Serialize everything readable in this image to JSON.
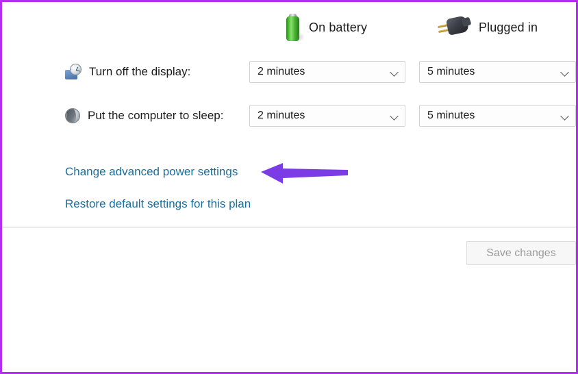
{
  "window": {
    "accent_border_color": "#b42ef0",
    "background_color": "#ffffff"
  },
  "columns": [
    {
      "id": "battery",
      "label": "On battery",
      "icon": "battery-icon"
    },
    {
      "id": "plugged",
      "label": "Plugged in",
      "icon": "power-plug-icon"
    }
  ],
  "settings": [
    {
      "id": "turn-off-display",
      "label": "Turn off the display:",
      "icon": "display-clock-icon",
      "on_battery": "2 minutes",
      "plugged_in": "5 minutes"
    },
    {
      "id": "put-computer-to-sleep",
      "label": "Put the computer to sleep:",
      "icon": "sleep-moon-icon",
      "on_battery": "2 minutes",
      "plugged_in": "5 minutes"
    }
  ],
  "links": [
    {
      "id": "advanced",
      "label": "Change advanced power settings",
      "color": "#1a6e9e"
    },
    {
      "id": "restore",
      "label": "Restore default settings for this plan",
      "color": "#1a6e9e"
    }
  ],
  "annotation": {
    "type": "left-pointing-arrow",
    "color": "#7b3ce6",
    "points_to": "Change advanced power settings"
  },
  "footer": {
    "save_label": "Save changes",
    "save_enabled": false,
    "save_text_color": "#9b9b9b"
  }
}
